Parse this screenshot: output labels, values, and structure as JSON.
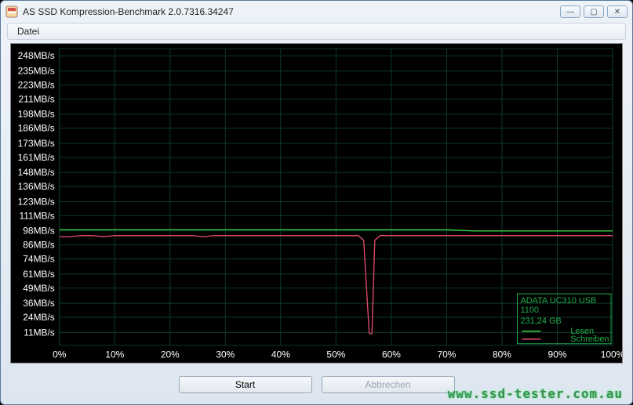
{
  "window": {
    "title": "AS SSD Kompression-Benchmark 2.0.7316.34247"
  },
  "menu": {
    "file": "Datei"
  },
  "buttons": {
    "start": "Start",
    "cancel": "Abbrechen"
  },
  "legend": {
    "device": "ADATA UC310 USB",
    "speed": "1100",
    "capacity": "231,24 GB",
    "read": "Lesen",
    "write": "Schreiben"
  },
  "watermark": "www.ssd-tester.com.au",
  "chart_data": {
    "type": "line",
    "title": "",
    "xlabel": "",
    "ylabel": "MB/s",
    "xlim": [
      0,
      100
    ],
    "ylim": [
      0,
      254
    ],
    "y_ticks": [
      11,
      24,
      36,
      49,
      61,
      74,
      86,
      98,
      111,
      123,
      136,
      148,
      161,
      173,
      186,
      198,
      211,
      223,
      235,
      248
    ],
    "y_tick_labels": [
      "11MB/s",
      "24MB/s",
      "36MB/s",
      "49MB/s",
      "61MB/s",
      "74MB/s",
      "86MB/s",
      "98MB/s",
      "111MB/s",
      "123MB/s",
      "136MB/s",
      "148MB/s",
      "161MB/s",
      "173MB/s",
      "186MB/s",
      "198MB/s",
      "211MB/s",
      "223MB/s",
      "235MB/s",
      "248MB/s"
    ],
    "x_ticks": [
      0,
      10,
      20,
      30,
      40,
      50,
      60,
      70,
      80,
      90,
      100
    ],
    "x_tick_labels": [
      "0%",
      "10%",
      "20%",
      "30%",
      "40%",
      "50%",
      "60%",
      "70%",
      "80%",
      "90%",
      "100%"
    ],
    "series": [
      {
        "name": "Lesen",
        "color": "#3bd13b",
        "x": [
          0,
          5,
          10,
          15,
          20,
          25,
          30,
          35,
          40,
          45,
          50,
          55,
          60,
          65,
          70,
          75,
          80,
          85,
          90,
          95,
          100
        ],
        "y": [
          99,
          99,
          99,
          99,
          99,
          99,
          99,
          99,
          99,
          99,
          99,
          99,
          99,
          99,
          99,
          98,
          98,
          98,
          98,
          98,
          98
        ]
      },
      {
        "name": "Schreiben",
        "color": "#d94a6a",
        "x": [
          0,
          2,
          4,
          6,
          8,
          10,
          12,
          14,
          16,
          18,
          20,
          22,
          24,
          26,
          28,
          30,
          32,
          34,
          36,
          38,
          40,
          42,
          44,
          46,
          48,
          50,
          52,
          54,
          55,
          56,
          56.5,
          57,
          58,
          60,
          62,
          64,
          66,
          68,
          70,
          72,
          74,
          76,
          78,
          80,
          82,
          84,
          86,
          88,
          90,
          92,
          94,
          96,
          98,
          100
        ],
        "y": [
          93,
          93,
          94,
          94,
          93,
          94,
          94,
          94,
          94,
          94,
          94,
          94,
          94,
          93,
          94,
          94,
          94,
          94,
          94,
          94,
          94,
          94,
          94,
          94,
          94,
          94,
          94,
          94,
          90,
          10,
          10,
          90,
          94,
          94,
          94,
          94,
          94,
          94,
          94,
          94,
          94,
          94,
          94,
          94,
          94,
          94,
          94,
          94,
          94,
          94,
          94,
          94,
          94,
          94
        ]
      }
    ]
  }
}
